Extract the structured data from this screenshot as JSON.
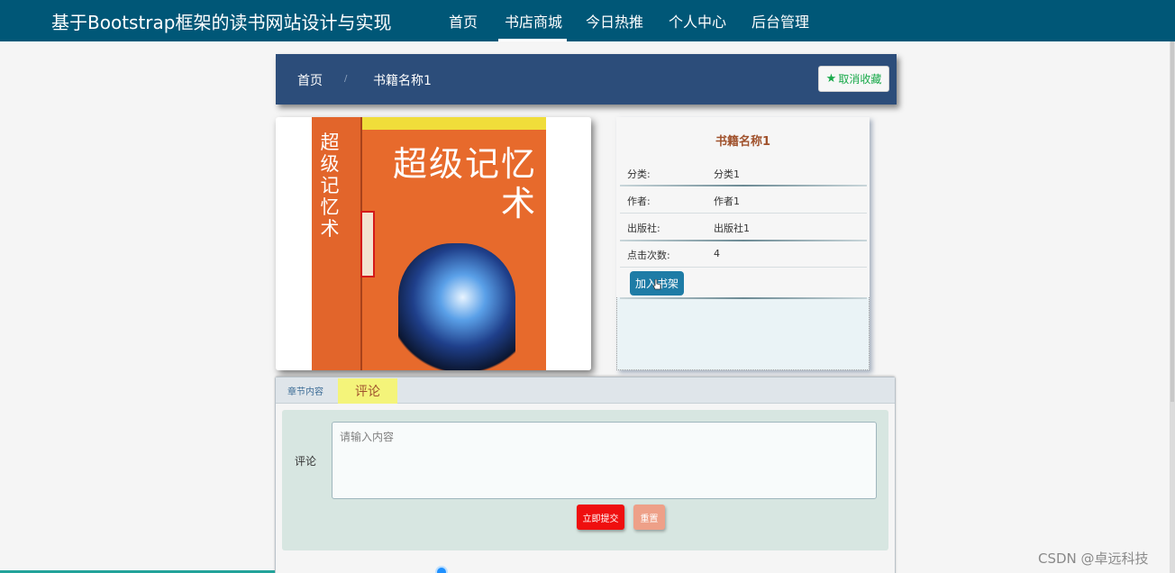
{
  "navbar": {
    "brand": "基于Bootstrap框架的读书网站设计与实现",
    "items": [
      {
        "label": "首页"
      },
      {
        "label": "书店商城"
      },
      {
        "label": "今日热推"
      },
      {
        "label": "个人中心"
      },
      {
        "label": "后台管理"
      }
    ],
    "active_index": 1
  },
  "breadcrumb": {
    "home": "首页",
    "separator": "/",
    "current": "书籍名称1",
    "favorite_button": "取消收藏"
  },
  "cover": {
    "title_vertical": "超级记忆术",
    "title_main": "超级记忆术"
  },
  "info": {
    "title": "书籍名称1",
    "rows": [
      {
        "label": "分类:",
        "value": "分类1"
      },
      {
        "label": "作者:",
        "value": "作者1"
      },
      {
        "label": "出版社:",
        "value": "出版社1"
      },
      {
        "label": "点击次数:",
        "value": "4"
      }
    ],
    "add_to_shelf": "加入书架"
  },
  "tabs": {
    "chapter": "章节内容",
    "comment": "评论"
  },
  "comment_form": {
    "label": "评论",
    "placeholder": "请输入内容",
    "submit": "立即提交",
    "reset": "重置"
  },
  "watermark": "CSDN @卓远科技",
  "colors": {
    "navbar": "#005777",
    "breadcrumb_bar": "#2c4d7a",
    "favorite_green": "#18a94a",
    "submit_red": "#ef0f0f",
    "reset_salmon": "#eea088",
    "comment_tab_yellow": "#f4f47a"
  }
}
